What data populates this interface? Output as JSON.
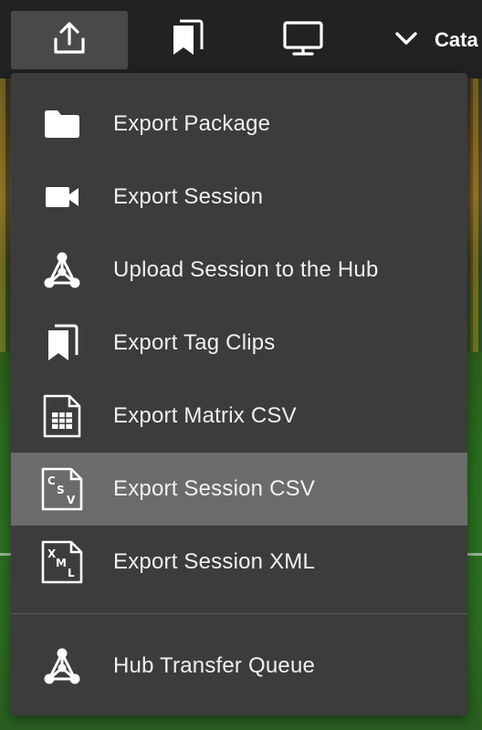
{
  "toolbar": {
    "buttons": [
      {
        "icon": "upload-icon"
      },
      {
        "icon": "bookmarks-icon"
      },
      {
        "icon": "monitor-icon"
      }
    ],
    "catalog": {
      "icon": "chevron-down-icon",
      "label": "Cata"
    }
  },
  "menu": {
    "items": [
      {
        "label": "Export Package",
        "icon": "folder-icon"
      },
      {
        "label": "Export Session",
        "icon": "video-camera-icon"
      },
      {
        "label": "Upload Session to the Hub",
        "icon": "hub-icon"
      },
      {
        "label": "Export Tag Clips",
        "icon": "bookmarks-icon"
      },
      {
        "label": "Export Matrix CSV",
        "icon": "table-file-icon"
      },
      {
        "label": "Export Session CSV",
        "icon": "csv-file-icon",
        "highlighted": true
      },
      {
        "label": "Export Session XML",
        "icon": "xml-file-icon"
      }
    ],
    "footer_item": {
      "label": "Hub Transfer Queue",
      "icon": "hub-icon"
    }
  },
  "colors": {
    "toolbar_bg": "#222222",
    "menu_bg": "#3c3c3c",
    "highlight_bg": "#6b6b6b",
    "active_button_bg": "#4a4a4a",
    "text": "#ffffff"
  }
}
